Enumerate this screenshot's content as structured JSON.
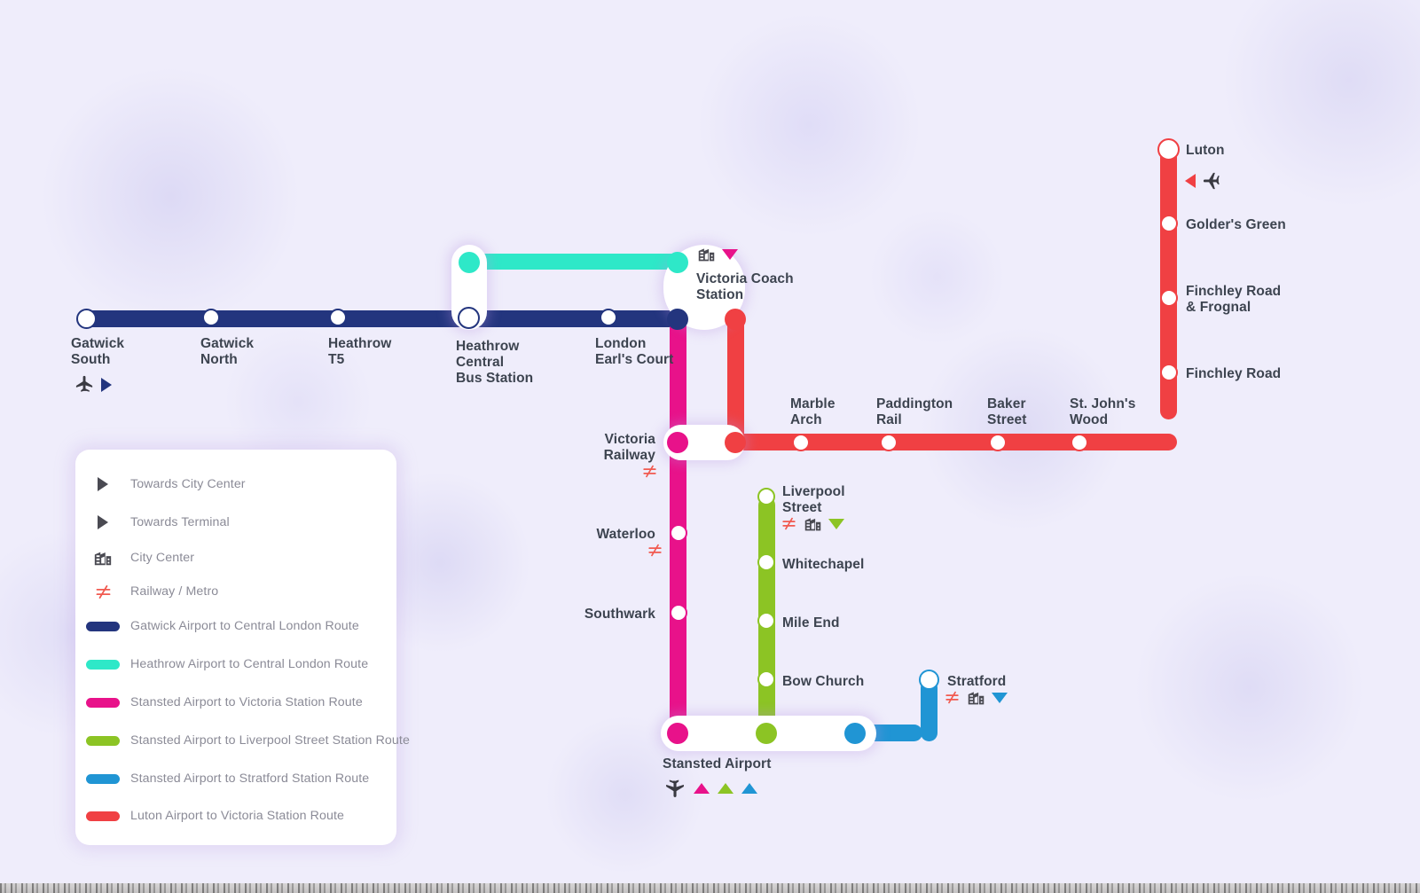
{
  "colors": {
    "gatwick_navy": "#23357e",
    "heathrow_cyan": "#2ee8c8",
    "stansted_pink": "#e8128a",
    "stansted_green": "#8cc424",
    "stansted_blue": "#2095d4",
    "luton_red": "#f04043",
    "railway_icon": "#f15a50",
    "city_icon": "#4a4a52",
    "plane_icon": "#3a3a42",
    "label_text": "#3d4450",
    "legend_text": "#8b8b97",
    "background": "#efedfb"
  },
  "legend": {
    "items": [
      {
        "label": "Towards City Center",
        "symbol": "triangle-right",
        "color": "#4a4a52"
      },
      {
        "label": "Towards Terminal",
        "symbol": "triangle-right",
        "color": "#4a4a52"
      },
      {
        "label": "City Center",
        "symbol": "city-icon",
        "color": "#4a4a52"
      },
      {
        "label": "Railway / Metro",
        "symbol": "railway-icon",
        "color": "#f15a50"
      },
      {
        "label": "Gatwick Airport to Central London Route",
        "symbol": "line-swatch",
        "color": "#23357e"
      },
      {
        "label": "Heathrow Airport to Central London Route",
        "symbol": "line-swatch",
        "color": "#2ee8c8"
      },
      {
        "label": "Stansted Airport to Victoria Station Route",
        "symbol": "line-swatch",
        "color": "#e8128a"
      },
      {
        "label": "Stansted Airport to Liverpool Street Station Route",
        "symbol": "line-swatch",
        "color": "#8cc424"
      },
      {
        "label": "Stansted Airport to Stratford Station Route",
        "symbol": "line-swatch",
        "color": "#2095d4"
      },
      {
        "label": "Luton Airport to Victoria Station Route",
        "symbol": "line-swatch",
        "color": "#f04043"
      }
    ]
  },
  "stations": {
    "gatwick_south": "Gatwick\nSouth",
    "gatwick_north": "Gatwick\nNorth",
    "heathrow_t5": "Heathrow\nT5",
    "heathrow_central": "Heathrow\nCentral\nBus Station",
    "london_earls_court": "London\nEarl's Court",
    "victoria_coach": "Victoria Coach\nStation",
    "victoria_railway": "Victoria\nRailway",
    "waterloo": "Waterloo",
    "southwark": "Southwark",
    "marble_arch": "Marble\nArch",
    "paddington_rail": "Paddington\nRail",
    "baker_street": "Baker\nStreet",
    "st_johns_wood": "St. John's\nWood",
    "finchley_road": "Finchley Road",
    "finchley_road_frognal": "Finchley Road\n& Frognal",
    "golders_green": "Golder's Green",
    "luton": "Luton",
    "liverpool_street": "Liverpool\nStreet",
    "whitechapel": "Whitechapel",
    "mile_end": "Mile End",
    "bow_church": "Bow Church",
    "stratford": "Stratford",
    "stansted_airport": "Stansted Airport"
  }
}
